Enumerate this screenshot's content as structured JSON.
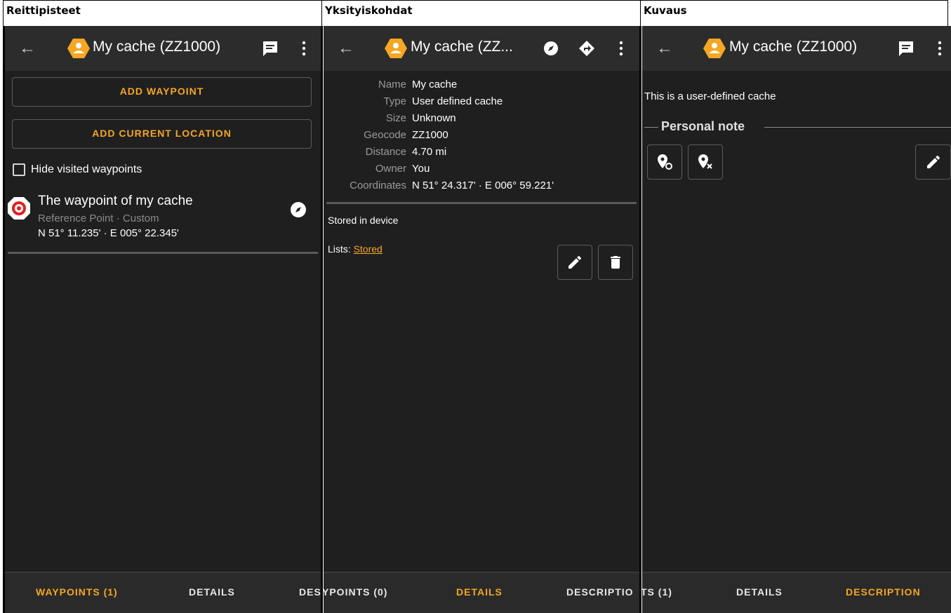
{
  "columns": {
    "waypoints": "Reittipisteet",
    "details": "Yksityiskohdat",
    "description": "Kuvaus"
  },
  "colors": {
    "accent": "#f5a623",
    "background": "#1f1f1f",
    "appbar": "#2c2c2c"
  },
  "screen1": {
    "title": "My cache (ZZ1000)",
    "add_waypoint": "ADD WAYPOINT",
    "add_current_location": "ADD CURRENT LOCATION",
    "hide_visited": "Hide visited waypoints",
    "waypoint": {
      "name": "The waypoint of my cache",
      "type": "Reference Point · Custom",
      "coords": "N 51° 11.235' · E 005° 22.345'"
    },
    "tabs": {
      "waypoints": "WAYPOINTS (1)",
      "details": "DETAILS",
      "description": "DES"
    }
  },
  "screen2": {
    "title": "My cache (ZZ...",
    "details": [
      {
        "label": "Name",
        "value": "My cache"
      },
      {
        "label": "Type",
        "value": "User defined cache"
      },
      {
        "label": "Size",
        "value": "Unknown"
      },
      {
        "label": "Geocode",
        "value": "ZZ1000"
      },
      {
        "label": "Distance",
        "value": "4.70 mi"
      },
      {
        "label": "Owner",
        "value": "You"
      },
      {
        "label": "Coordinates",
        "value": "N 51° 24.317' · E 006° 59.221'"
      }
    ],
    "stored": "Stored in device",
    "lists_label": "Lists:",
    "lists_value": "Stored",
    "tabs": {
      "waypoints": "YPOINTS (0)",
      "details": "DETAILS",
      "description": "DESCRIPTIO"
    }
  },
  "screen3": {
    "title": "My cache (ZZ1000)",
    "description": "This is a user-defined cache",
    "personal_note": "Personal note",
    "tabs": {
      "waypoints": "TS (1)",
      "details": "DETAILS",
      "description": "DESCRIPTION"
    }
  }
}
